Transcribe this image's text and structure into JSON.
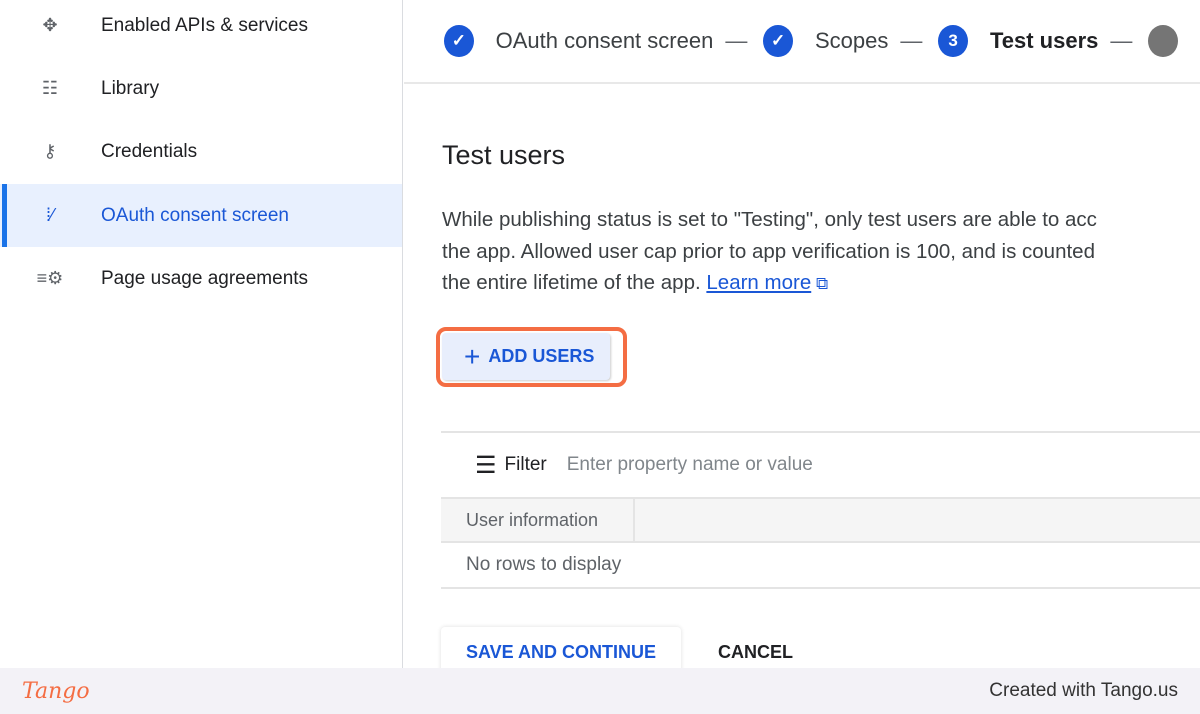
{
  "sidebar": {
    "items": [
      {
        "label": "Enabled APIs & services",
        "icon": "api-icon"
      },
      {
        "label": "Library",
        "icon": "library-icon"
      },
      {
        "label": "Credentials",
        "icon": "key-icon"
      },
      {
        "label": "OAuth consent screen",
        "icon": "consent-icon",
        "active": true
      },
      {
        "label": "Page usage agreements",
        "icon": "settings-list-icon"
      }
    ]
  },
  "stepper": {
    "steps": [
      {
        "label": "OAuth consent screen",
        "state": "done"
      },
      {
        "label": "Scopes",
        "state": "done"
      },
      {
        "label": "Test users",
        "number": "3",
        "state": "current"
      }
    ]
  },
  "main": {
    "title": "Test users",
    "para_line1": "While publishing status is set to \"Testing\", only test users are able to acc",
    "para_line2": "the app. Allowed user cap prior to app verification is 100, and is counted",
    "para_line3": "the entire lifetime of the app. ",
    "learn_more": "Learn more",
    "add_users": "ADD USERS",
    "filter_label": "Filter",
    "filter_placeholder": "Enter property name or value",
    "table_header": "User information",
    "empty_text": "No rows to display",
    "save": "SAVE AND CONTINUE",
    "cancel": "CANCEL"
  },
  "footer": {
    "logo": "Tango",
    "credit": "Created with Tango.us"
  },
  "colors": {
    "accent": "#1a57d6",
    "highlight": "#f46d43"
  }
}
